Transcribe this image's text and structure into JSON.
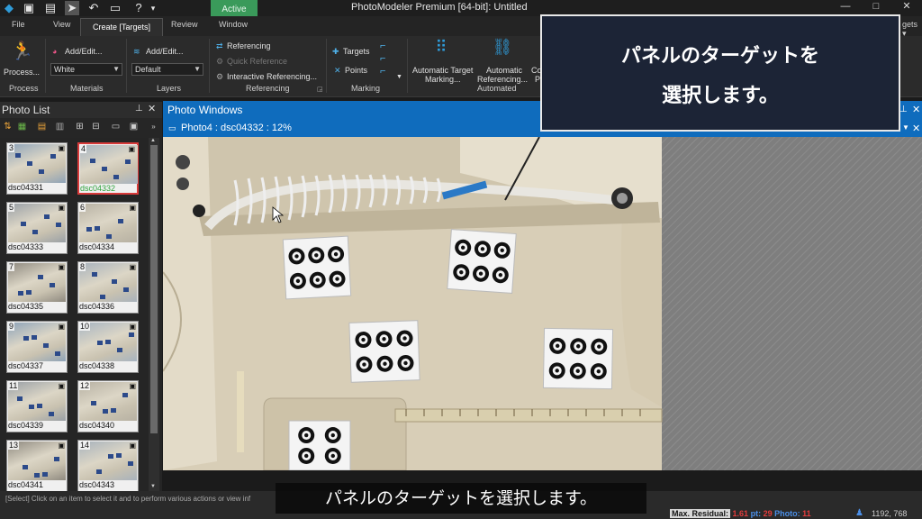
{
  "window": {
    "title": "PhotoModeler Premium [64-bit]: Untitled",
    "context_tag": "Active",
    "controls": {
      "minimize": "—",
      "maximize": "□",
      "close": "✕"
    }
  },
  "menu": {
    "tabs": [
      "File",
      "View",
      "Create [Targets]",
      "Review",
      "Window"
    ],
    "right_clipped": "gets ▾"
  },
  "ribbon": {
    "process": {
      "button": "Process...",
      "group": "Process"
    },
    "materials": {
      "button": "Add/Edit...",
      "value": "White",
      "group": "Materials"
    },
    "layers": {
      "button": "Add/Edit...",
      "value": "Default",
      "group": "Layers"
    },
    "referencing": {
      "items": [
        "Referencing",
        "Quick Reference",
        "Interactive Referencing..."
      ],
      "group": "Referencing"
    },
    "marking": {
      "targets": "Targets",
      "points": "Points",
      "group": "Marking"
    },
    "automatic": {
      "target_marking": [
        "Automatic Target",
        "Marking..."
      ],
      "referencing": [
        "Automatic",
        "Referencing..."
      ],
      "group": "Automated",
      "clipped": [
        "Co",
        "P"
      ]
    }
  },
  "photo_list": {
    "title": "Photo List",
    "thumbs": [
      {
        "num": "3",
        "label": "dsc04331",
        "selected": false
      },
      {
        "num": "4",
        "label": "dsc04332",
        "selected": true
      },
      {
        "num": "5",
        "label": "dsc04333",
        "selected": false
      },
      {
        "num": "6",
        "label": "dsc04334",
        "selected": false
      },
      {
        "num": "7",
        "label": "dsc04335",
        "selected": false
      },
      {
        "num": "8",
        "label": "dsc04336",
        "selected": false
      },
      {
        "num": "9",
        "label": "dsc04337",
        "selected": false
      },
      {
        "num": "10",
        "label": "dsc04338",
        "selected": false
      },
      {
        "num": "11",
        "label": "dsc04339",
        "selected": false
      },
      {
        "num": "12",
        "label": "dsc04340",
        "selected": false
      },
      {
        "num": "13",
        "label": "dsc04341",
        "selected": false
      },
      {
        "num": "14",
        "label": "dsc04343",
        "selected": false
      }
    ]
  },
  "photo_windows": {
    "title": "Photo Windows",
    "tab_title": "Photo4 : dsc04332 : 12%"
  },
  "status": {
    "message": "[Select] Click on an item to select it and to perform various actions or view inf",
    "max_residual_label": "Max. Residual:",
    "max_residual_value": "1.61",
    "pt_label": "pt:",
    "pt_value": "29",
    "photo_label": "Photo:",
    "photo_value": "11",
    "coords": "1192, 768"
  },
  "overlay": {
    "callout_line1": "パネルのターゲットを",
    "callout_line2": "選択します。",
    "subtitle": "パネルのターゲットを選択します。"
  }
}
